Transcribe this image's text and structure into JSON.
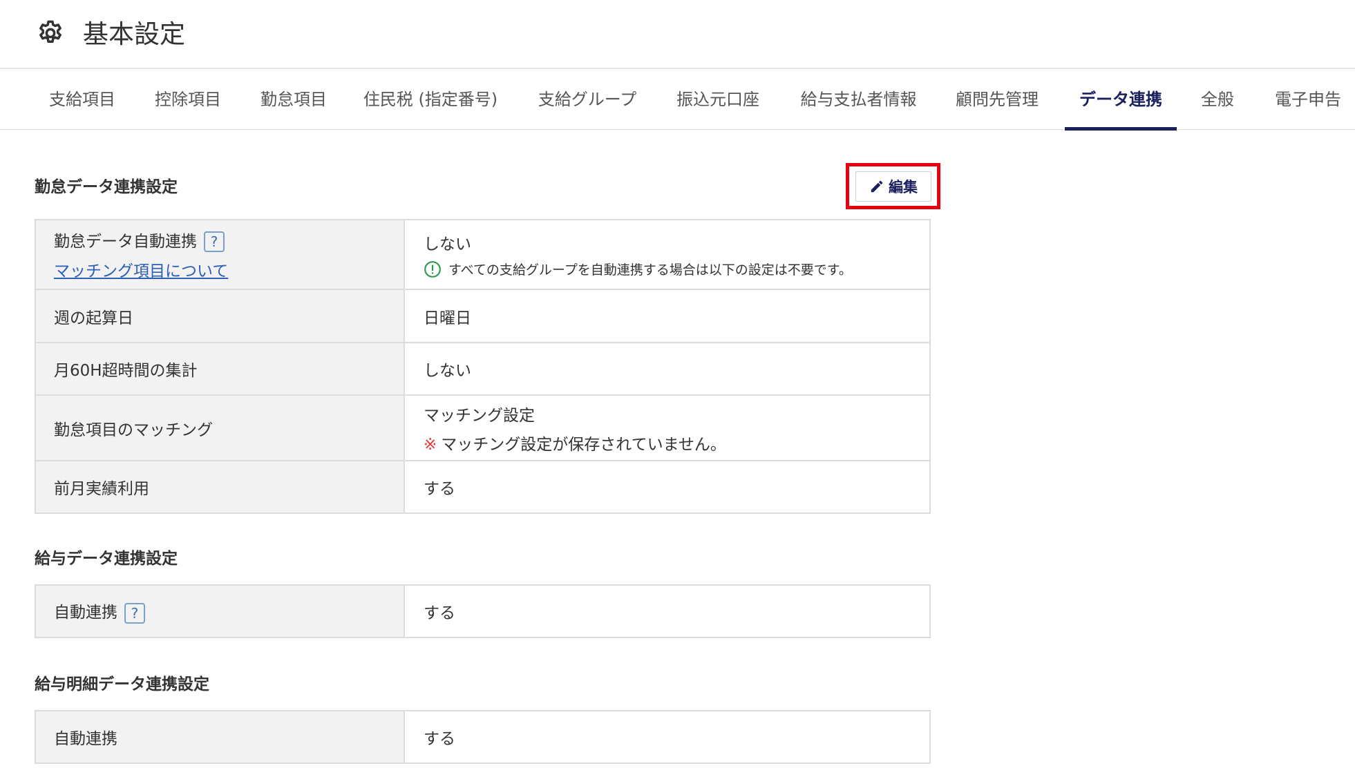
{
  "header": {
    "title": "基本設定",
    "icon": "gear-icon"
  },
  "tabs": [
    {
      "label": "支給項目",
      "active": false
    },
    {
      "label": "控除項目",
      "active": false
    },
    {
      "label": "勤怠項目",
      "active": false
    },
    {
      "label": "住民税 (指定番号)",
      "active": false
    },
    {
      "label": "支給グループ",
      "active": false
    },
    {
      "label": "振込元口座",
      "active": false
    },
    {
      "label": "給与支払者情報",
      "active": false
    },
    {
      "label": "顧問先管理",
      "active": false
    },
    {
      "label": "データ連携",
      "active": true
    },
    {
      "label": "全般",
      "active": false
    },
    {
      "label": "電子申告",
      "active": false
    }
  ],
  "edit_button": {
    "label": "編集",
    "icon": "pencil-icon"
  },
  "sections": {
    "attendance": {
      "title": "勤怠データ連携設定",
      "rows": {
        "auto": {
          "label": "勤怠データ自動連携",
          "help": "?",
          "link": "マッチング項目について",
          "value": "しない",
          "note": "すべての支給グループを自動連携する場合は以下の設定は不要です。"
        },
        "week_start": {
          "label": "週の起算日",
          "value": "日曜日"
        },
        "over60": {
          "label": "月60H超時間の集計",
          "value": "しない"
        },
        "matching": {
          "label": "勤怠項目のマッチング",
          "value": "マッチング設定",
          "warn_mark": "※",
          "warn": "マッチング設定が保存されていません。"
        },
        "prev_month": {
          "label": "前月実績利用",
          "value": "する"
        }
      }
    },
    "payroll": {
      "title": "給与データ連携設定",
      "rows": {
        "auto": {
          "label": "自動連携",
          "help": "?",
          "value": "する"
        }
      }
    },
    "payslip": {
      "title": "給与明細データ連携設定",
      "rows": {
        "auto": {
          "label": "自動連携",
          "value": "する"
        }
      }
    }
  },
  "colors": {
    "accent": "#1b1f5c",
    "highlight": "#e8000f",
    "link": "#2a60b8",
    "info": "#2e9a4e",
    "warning": "#e23b3b"
  }
}
